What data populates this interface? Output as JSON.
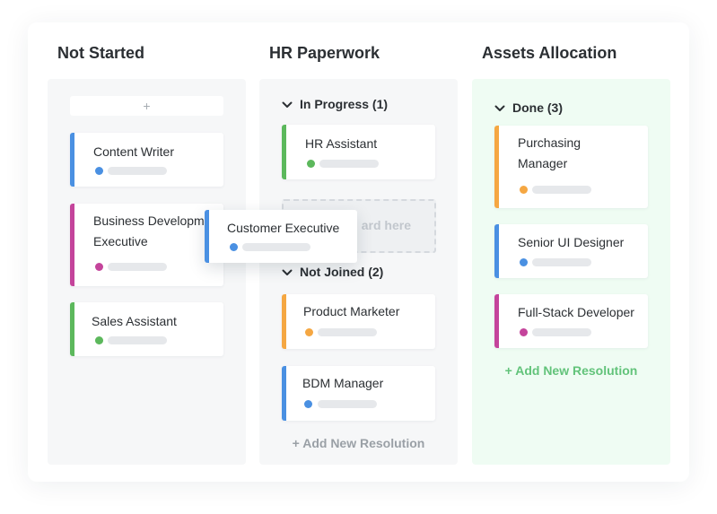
{
  "colors": {
    "blue": "#4a90e2",
    "pink": "#c4449b",
    "green": "#5cb85c",
    "orange": "#f5a742",
    "add_resolution_green": "#62c37a"
  },
  "columns": [
    {
      "title": "Not Started",
      "add_label": "+",
      "cards": [
        {
          "title": "Content Writer",
          "color": "blue"
        },
        {
          "title": "Business Development Executive",
          "color": "pink"
        },
        {
          "title": "Sales Assistant",
          "color": "green"
        }
      ]
    },
    {
      "title": "HR Paperwork",
      "groups": [
        {
          "label": "In Progress (1)",
          "cards": [
            {
              "title": "HR Assistant",
              "color": "green"
            }
          ]
        },
        {
          "label": "Not Joined (2)",
          "cards": [
            {
              "title": "Product Marketer",
              "color": "orange"
            },
            {
              "title": "BDM Manager",
              "color": "blue"
            }
          ]
        }
      ],
      "drop_zone_text": "ard here",
      "add_resolution": "+ Add New Resolution"
    },
    {
      "title": "Assets Allocation",
      "groups": [
        {
          "label": "Done (3)",
          "cards": [
            {
              "title": "Purchasing Manager",
              "color": "orange"
            },
            {
              "title": "Senior UI Designer",
              "color": "blue"
            },
            {
              "title": "Full-Stack Developer",
              "color": "pink"
            }
          ]
        }
      ],
      "add_resolution": "+ Add New Resolution"
    }
  ],
  "dragging_card": {
    "title": "Customer Executive",
    "color": "blue"
  }
}
